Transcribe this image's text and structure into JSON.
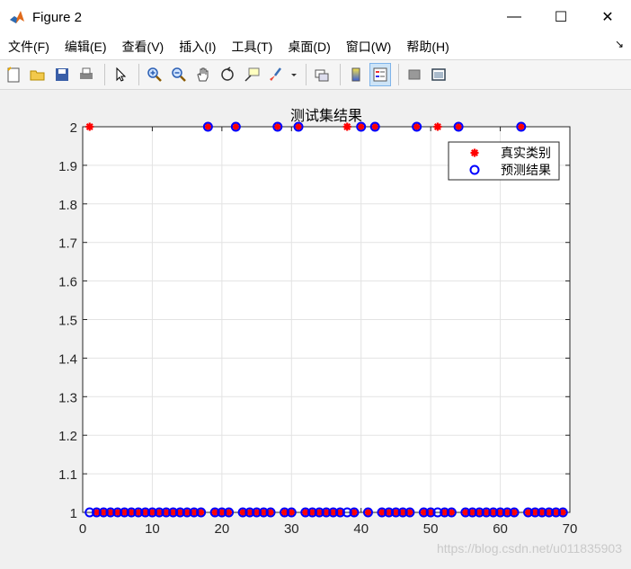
{
  "window": {
    "title": "Figure 2",
    "controls": {
      "minimize": "—",
      "maximize": "☐",
      "close": "✕"
    }
  },
  "menu": {
    "items": [
      "文件(F)",
      "编辑(E)",
      "查看(V)",
      "插入(I)",
      "工具(T)",
      "桌面(D)",
      "窗口(W)",
      "帮助(H)"
    ],
    "overflow_icon": "dock-arrow-icon"
  },
  "toolbar": {
    "buttons": [
      {
        "icon": "new-figure-icon"
      },
      {
        "icon": "open-file-icon"
      },
      {
        "icon": "save-icon"
      },
      {
        "icon": "print-icon"
      },
      {
        "icon": "pointer-icon"
      },
      {
        "icon": "zoom-in-icon"
      },
      {
        "icon": "zoom-out-icon"
      },
      {
        "icon": "pan-icon"
      },
      {
        "icon": "rotate-icon"
      },
      {
        "icon": "data-cursor-icon"
      },
      {
        "icon": "brush-icon"
      },
      {
        "icon": "link-plot-icon"
      },
      {
        "icon": "colorbar-icon"
      },
      {
        "icon": "legend-icon"
      },
      {
        "icon": "hide-plot-tools-icon"
      },
      {
        "icon": "show-plot-tools-icon"
      }
    ]
  },
  "watermark": "https://blog.csdn.net/u011835903",
  "colors": {
    "true_marker": "#ff0000",
    "pred_marker": "#0000ff",
    "grid": "#e3e3e3"
  },
  "chart_data": {
    "type": "scatter",
    "title": "测试集结果",
    "xlim": [
      0,
      70
    ],
    "ylim": [
      1,
      2
    ],
    "xticks": [
      0,
      10,
      20,
      30,
      40,
      50,
      60,
      70
    ],
    "yticks": [
      1,
      1.1,
      1.2,
      1.3,
      1.4,
      1.5,
      1.6,
      1.7,
      1.8,
      1.9,
      2
    ],
    "grid": true,
    "legend_position": "top-right",
    "series": [
      {
        "name": "真实类别",
        "marker": "asterisk",
        "color": "#ff0000",
        "x": [
          1,
          2,
          3,
          4,
          5,
          6,
          7,
          8,
          9,
          10,
          11,
          12,
          13,
          14,
          15,
          16,
          17,
          18,
          19,
          20,
          21,
          22,
          23,
          24,
          25,
          26,
          27,
          28,
          29,
          30,
          31,
          32,
          33,
          34,
          35,
          36,
          37,
          38,
          39,
          40,
          41,
          42,
          43,
          44,
          45,
          46,
          47,
          48,
          49,
          50,
          51,
          52,
          53,
          54,
          55,
          56,
          57,
          58,
          59,
          60,
          61,
          62,
          63,
          64,
          65,
          66,
          67,
          68,
          69
        ],
        "y": [
          2,
          1,
          1,
          1,
          1,
          1,
          1,
          1,
          1,
          1,
          1,
          1,
          1,
          1,
          1,
          1,
          1,
          2,
          1,
          1,
          1,
          2,
          1,
          1,
          1,
          1,
          1,
          2,
          1,
          1,
          2,
          1,
          1,
          1,
          1,
          1,
          1,
          2,
          1,
          2,
          1,
          2,
          1,
          1,
          1,
          1,
          1,
          2,
          1,
          1,
          2,
          1,
          1,
          2,
          1,
          1,
          1,
          1,
          1,
          1,
          1,
          1,
          2,
          1,
          1,
          1,
          1,
          1,
          1
        ]
      },
      {
        "name": "预测结果",
        "marker": "circle",
        "color": "#0000ff",
        "x": [
          1,
          2,
          3,
          4,
          5,
          6,
          7,
          8,
          9,
          10,
          11,
          12,
          13,
          14,
          15,
          16,
          17,
          18,
          19,
          20,
          21,
          22,
          23,
          24,
          25,
          26,
          27,
          28,
          29,
          30,
          31,
          32,
          33,
          34,
          35,
          36,
          37,
          38,
          39,
          40,
          41,
          42,
          43,
          44,
          45,
          46,
          47,
          48,
          49,
          50,
          51,
          52,
          53,
          54,
          55,
          56,
          57,
          58,
          59,
          60,
          61,
          62,
          63,
          64,
          65,
          66,
          67,
          68,
          69
        ],
        "y": [
          1,
          1,
          1,
          1,
          1,
          1,
          1,
          1,
          1,
          1,
          1,
          1,
          1,
          1,
          1,
          1,
          1,
          2,
          1,
          1,
          1,
          2,
          1,
          1,
          1,
          1,
          1,
          2,
          1,
          1,
          2,
          1,
          1,
          1,
          1,
          1,
          1,
          1,
          1,
          2,
          1,
          2,
          1,
          1,
          1,
          1,
          1,
          2,
          1,
          1,
          1,
          1,
          1,
          2,
          1,
          1,
          1,
          1,
          1,
          1,
          1,
          1,
          2,
          1,
          1,
          1,
          1,
          1,
          1
        ]
      }
    ]
  }
}
